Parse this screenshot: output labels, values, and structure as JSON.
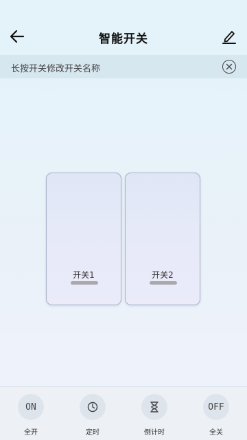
{
  "header": {
    "title": "智能开关",
    "back_icon": "arrow-left-icon",
    "edit_icon": "pencil-icon"
  },
  "tip": {
    "text": "长按开关修改开关名称",
    "close_icon": "close-circle-icon"
  },
  "switches": [
    {
      "label": "开关1"
    },
    {
      "label": "开关2"
    }
  ],
  "bottom_actions": [
    {
      "icon_text": "ON",
      "label": "全开",
      "icon": "on-icon"
    },
    {
      "icon_text": "",
      "label": "定时",
      "icon": "clock-icon"
    },
    {
      "icon_text": "",
      "label": "倒计时",
      "icon": "hourglass-icon"
    },
    {
      "icon_text": "OFF",
      "label": "全关",
      "icon": "off-icon"
    }
  ]
}
